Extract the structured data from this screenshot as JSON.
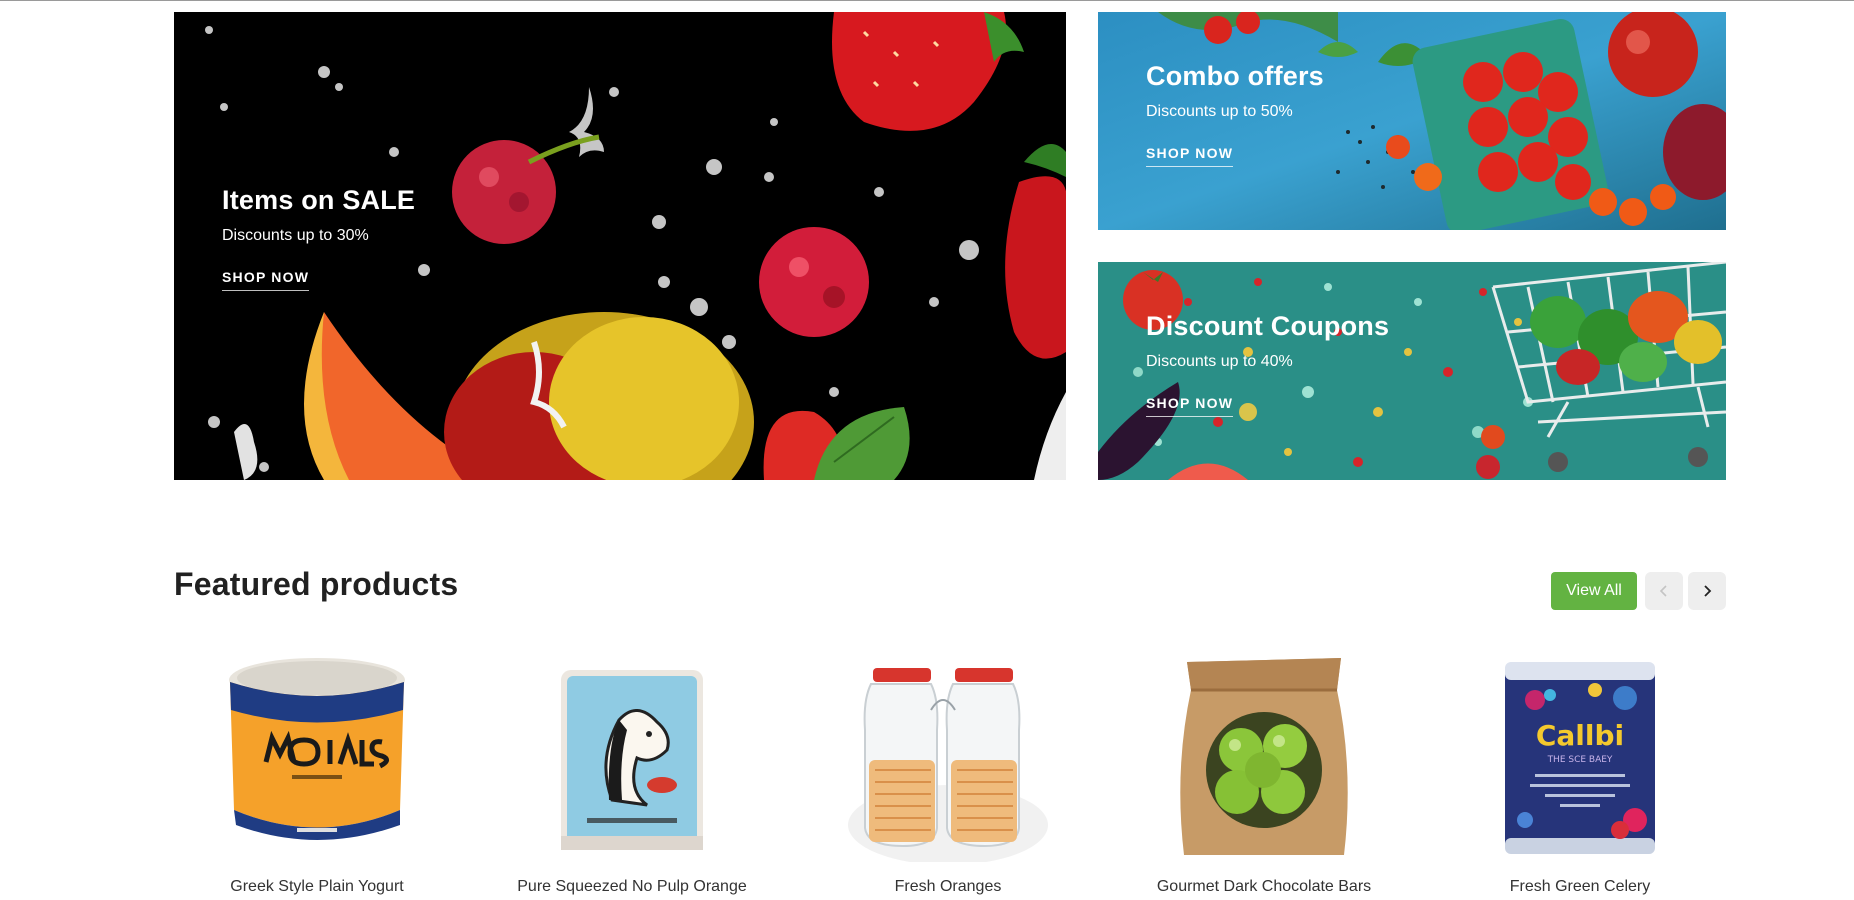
{
  "banners": {
    "sale": {
      "title": "Items on SALE",
      "subtitle": "Discounts up to 30%",
      "cta": "SHOP NOW"
    },
    "combo": {
      "title": "Combo offers",
      "subtitle": "Discounts up to 50%",
      "cta": "SHOP NOW"
    },
    "coupon": {
      "title": "Discount Coupons",
      "subtitle": "Discounts up to 40%",
      "cta": "SHOP NOW"
    }
  },
  "featured": {
    "title": "Featured products",
    "view_all": "View All",
    "prev_icon": "chevron-left-icon",
    "next_icon": "chevron-right-icon",
    "products": [
      {
        "name": "Greek Style Plain Yogurt"
      },
      {
        "name": "Pure Squeezed No Pulp Orange"
      },
      {
        "name": "Fresh Oranges"
      },
      {
        "name": "Gourmet Dark Chocolate Bars"
      },
      {
        "name": "Fresh Green Celery"
      }
    ]
  },
  "colors": {
    "accent_green": "#63b342",
    "nav_button_bg": "#eeeeee",
    "heading_text": "#212121"
  }
}
